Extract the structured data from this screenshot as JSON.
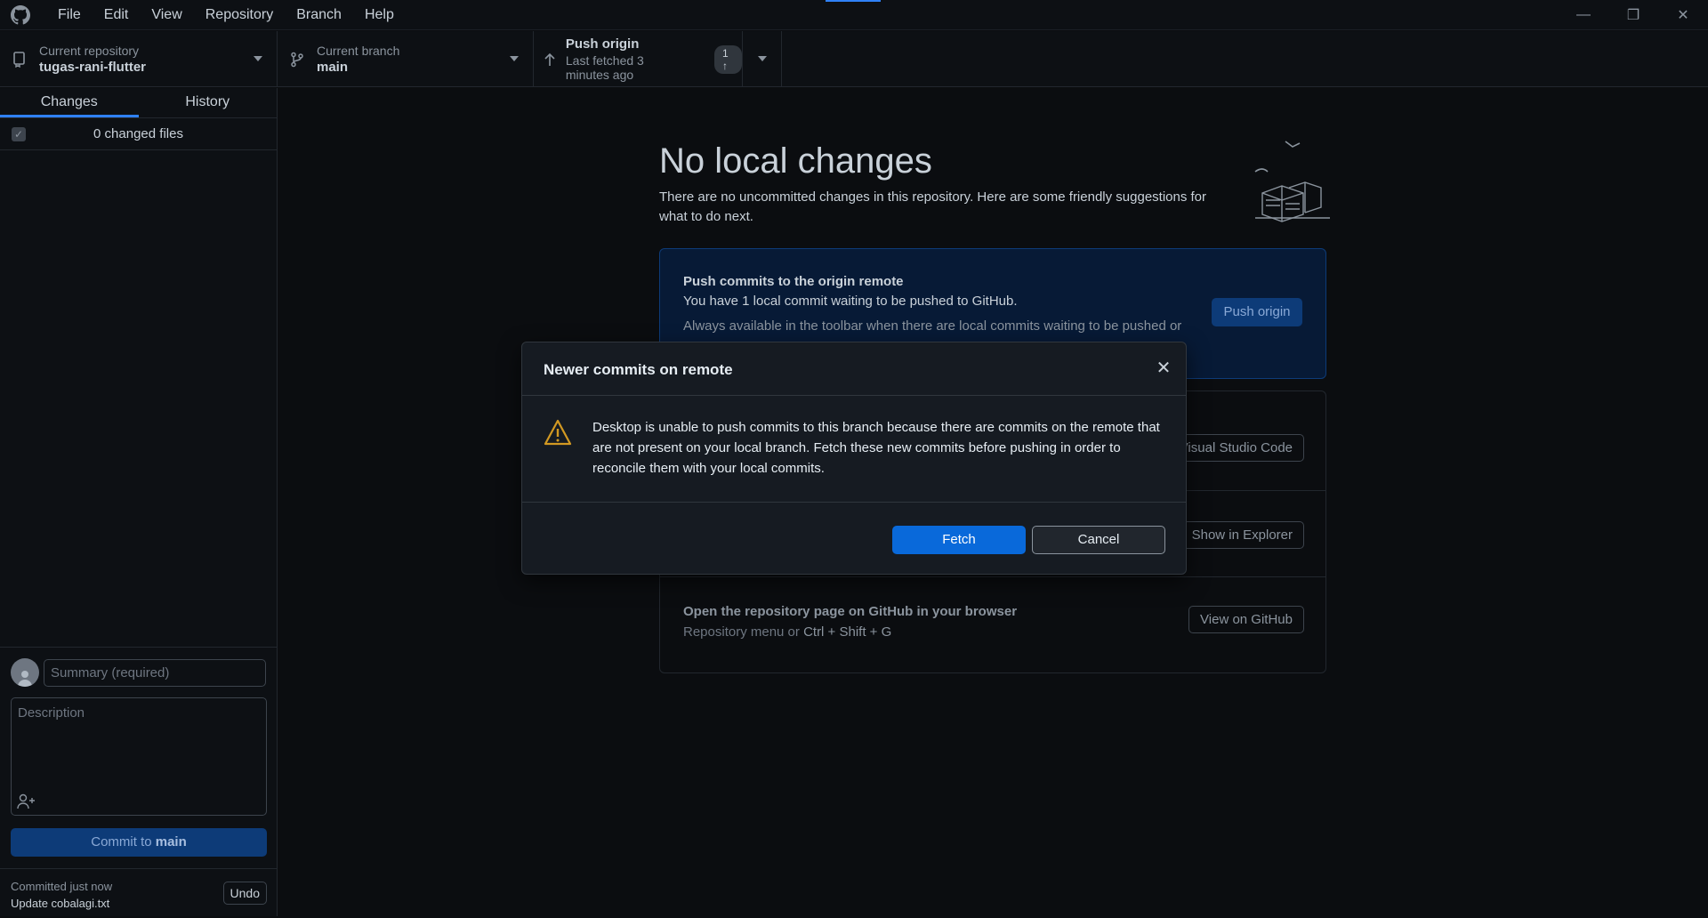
{
  "menu": [
    "File",
    "Edit",
    "View",
    "Repository",
    "Branch",
    "Help"
  ],
  "toolbar": {
    "repo_label": "Current repository",
    "repo_value": "tugas-rani-flutter",
    "branch_label": "Current branch",
    "branch_value": "main",
    "push_label": "Push origin",
    "push_sub": "Last fetched 3 minutes ago",
    "push_badge": "1 ↑"
  },
  "sidebar": {
    "tab_changes": "Changes",
    "tab_history": "History",
    "changed_files": "0 changed files",
    "summary_placeholder": "Summary (required)",
    "description_placeholder": "Description",
    "commit_prefix": "Commit to ",
    "commit_branch": "main",
    "last_commit_time": "Committed just now",
    "last_commit_msg": "Update cobalagi.txt",
    "undo_label": "Undo"
  },
  "main": {
    "heading": "No local changes",
    "subtext": "There are no uncommitted changes in this repository. Here are some friendly suggestions for what to do next.",
    "push_panel": {
      "title": "Push commits to the origin remote",
      "desc": "You have 1 local commit waiting to be pushed to GitHub.",
      "desc2": "Always available in the toolbar when there are local commits waiting to be pushed or",
      "button": "Push origin"
    },
    "rows": {
      "editor_button": "Open in Visual Studio Code",
      "explorer_button": "Show in Explorer",
      "github_title": "Open the repository page on GitHub in your browser",
      "github_desc_prefix": "Repository menu or ",
      "github_kbd": "Ctrl + Shift + G",
      "github_button": "View on GitHub"
    }
  },
  "dialog": {
    "title": "Newer commits on remote",
    "message": "Desktop is unable to push commits to this branch because there are commits on the remote that are not present on your local branch. Fetch these new commits before pushing in order to reconcile them with your local commits.",
    "fetch_label": "Fetch",
    "cancel_label": "Cancel"
  }
}
